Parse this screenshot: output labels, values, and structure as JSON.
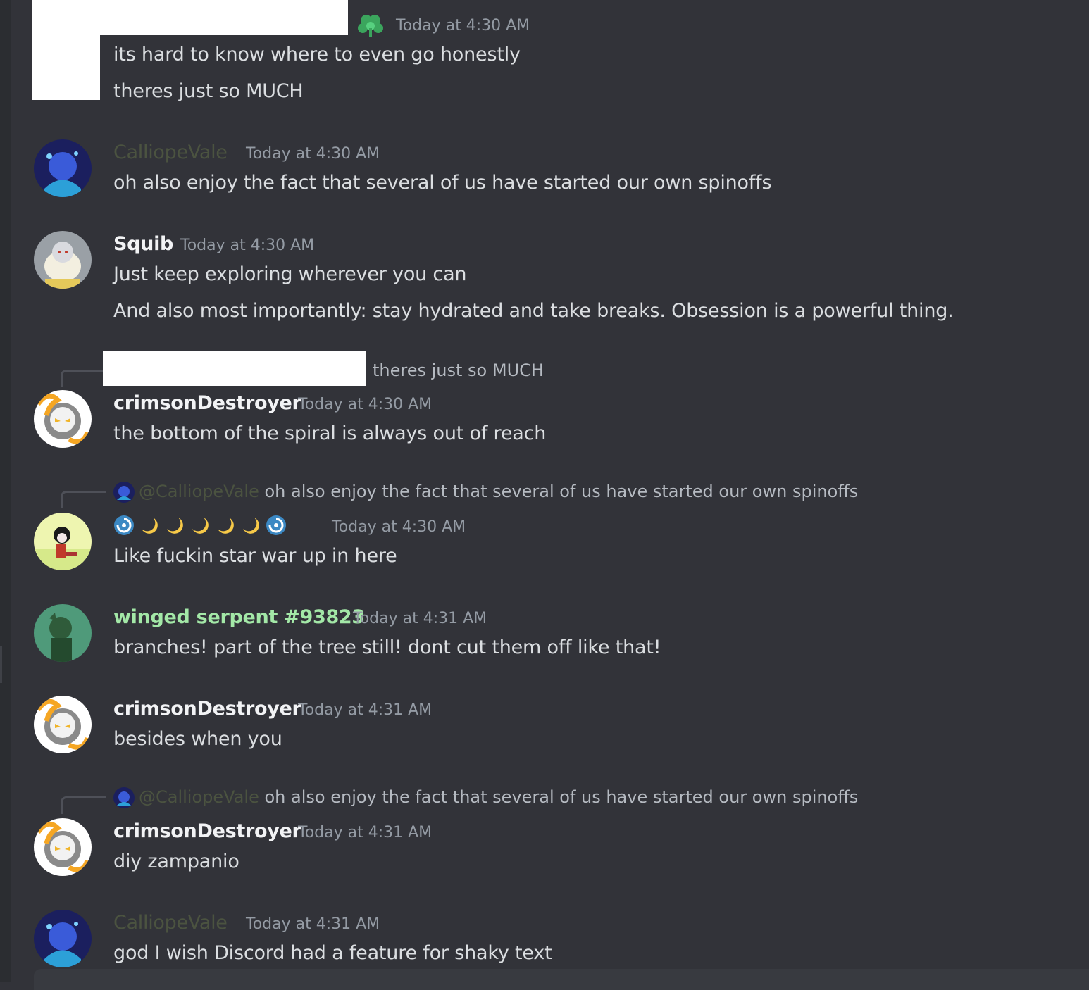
{
  "theme": {
    "background": "#323339",
    "username_dim": "#4b5340",
    "username_green": "#a3e8a7",
    "timestamp": "#949ba4"
  },
  "messages": [
    {
      "timestamp": "Today at 4:30 AM",
      "lines": [
        "its hard to know where to even go honestly",
        "theres just so MUCH"
      ],
      "decoration": "green-clover-icon"
    },
    {
      "username": "CalliopeVale",
      "timestamp": "Today at 4:30 AM",
      "lines": [
        "oh also enjoy the fact that several of us have started our own spinoffs"
      ]
    },
    {
      "username": "Squib",
      "timestamp": "Today at 4:30 AM",
      "lines": [
        "Just keep exploring wherever you can",
        "And also most importantly: stay hydrated and take breaks. Obsession is a powerful thing."
      ]
    },
    {
      "reply": {
        "text": "theres just so MUCH"
      },
      "username": "crimsonDestroyer",
      "timestamp": "Today at 4:30 AM",
      "lines": [
        "the bottom of the spiral is always out of reach"
      ]
    },
    {
      "reply": {
        "mention": "@CalliopeVale",
        "text": "oh also enjoy the fact that several of us have started our own spinoffs"
      },
      "username_emojis": [
        "cyclone-icon",
        "crescent-moon-icon",
        "crescent-moon-icon",
        "crescent-moon-icon",
        "crescent-moon-icon",
        "crescent-moon-icon",
        "cyclone-icon"
      ],
      "timestamp": "Today at 4:30 AM",
      "lines": [
        "Like fuckin star war up in here"
      ]
    },
    {
      "username": "winged serpent #93823",
      "timestamp": "Today at 4:31 AM",
      "lines": [
        "branches! part of the tree still! dont cut them off like that!"
      ]
    },
    {
      "username": "crimsonDestroyer",
      "timestamp": "Today at 4:31 AM",
      "lines": [
        "besides when you"
      ]
    },
    {
      "reply": {
        "mention": "@CalliopeVale",
        "text": "oh also enjoy the fact that several of us have started our own spinoffs"
      },
      "username": "crimsonDestroyer",
      "timestamp": "Today at 4:31 AM",
      "lines": [
        "diy zampanio"
      ]
    },
    {
      "username": "CalliopeVale",
      "timestamp": "Today at 4:31 AM",
      "lines": [
        "god I wish Discord had a feature for shaky text"
      ]
    }
  ]
}
